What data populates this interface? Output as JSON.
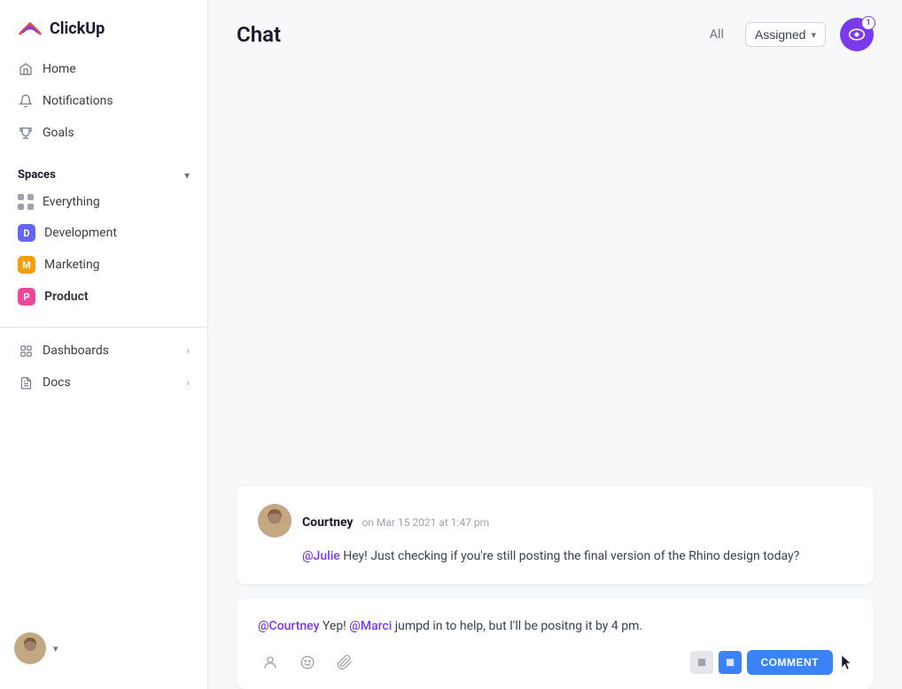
{
  "app": {
    "name": "ClickUp"
  },
  "sidebar": {
    "nav": [
      {
        "id": "home",
        "label": "Home",
        "icon": "home-icon"
      },
      {
        "id": "notifications",
        "label": "Notifications",
        "icon": "bell-icon"
      },
      {
        "id": "goals",
        "label": "Goals",
        "icon": "trophy-icon"
      }
    ],
    "spaces_label": "Spaces",
    "spaces": [
      {
        "id": "everything",
        "label": "Everything",
        "type": "dots"
      },
      {
        "id": "development",
        "label": "Development",
        "type": "badge",
        "color": "#6366f1",
        "letter": "D"
      },
      {
        "id": "marketing",
        "label": "Marketing",
        "type": "badge",
        "color": "#f59e0b",
        "letter": "M"
      },
      {
        "id": "product",
        "label": "Product",
        "type": "badge",
        "color": "#ec4899",
        "letter": "P",
        "active": true
      }
    ],
    "footer": [
      {
        "id": "dashboards",
        "label": "Dashboards"
      },
      {
        "id": "docs",
        "label": "Docs"
      }
    ]
  },
  "chat": {
    "title": "Chat",
    "filter_all": "All",
    "filter_assigned": "Assigned",
    "watch_count": "1",
    "messages": [
      {
        "id": "msg1",
        "author": "Courtney",
        "time": "on Mar 15 2021 at 1:47 pm",
        "mention": "@Julie",
        "body": " Hey! Just checking if you're still posting the final version of the Rhino design today?"
      }
    ],
    "reply": {
      "mention1": "@Courtney",
      "text1": " Yep! ",
      "mention2": "@Marci",
      "text2": " jumpd in to help, but I'll be positng it by 4 pm."
    },
    "toolbar": {
      "comment_label": "COMMENT"
    }
  }
}
